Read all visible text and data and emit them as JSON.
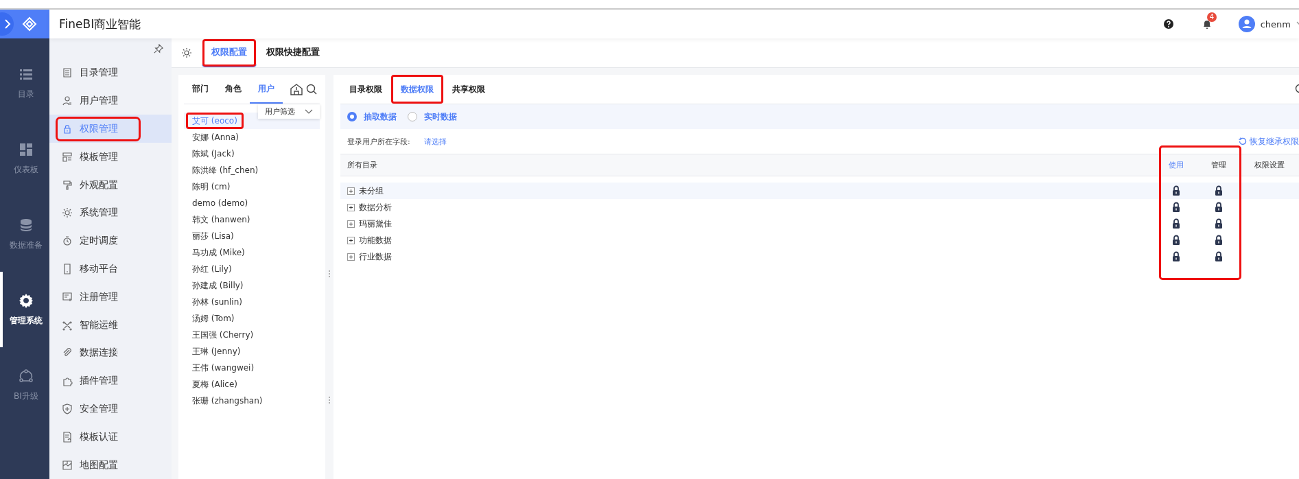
{
  "app": {
    "title": "FineBI商业智能"
  },
  "header": {
    "notification_count": "4",
    "user_name": "chenm"
  },
  "nav": [
    {
      "label": "目录",
      "selected": false
    },
    {
      "label": "仪表板",
      "selected": false
    },
    {
      "label": "数据准备",
      "selected": false
    },
    {
      "label": "管理系统",
      "selected": true
    },
    {
      "label": "BI升级",
      "selected": false
    }
  ],
  "sidebar": {
    "items": [
      {
        "label": "目录管理",
        "selected": false,
        "marked": false
      },
      {
        "label": "用户管理",
        "selected": false,
        "marked": false
      },
      {
        "label": "权限管理",
        "selected": true,
        "marked": true
      },
      {
        "label": "模板管理",
        "selected": false,
        "marked": false
      },
      {
        "label": "外观配置",
        "selected": false,
        "marked": false
      },
      {
        "label": "系统管理",
        "selected": false,
        "marked": false
      },
      {
        "label": "定时调度",
        "selected": false,
        "marked": false
      },
      {
        "label": "移动平台",
        "selected": false,
        "marked": false
      },
      {
        "label": "注册管理",
        "selected": false,
        "marked": false
      },
      {
        "label": "智能运维",
        "selected": false,
        "marked": false
      },
      {
        "label": "数据连接",
        "selected": false,
        "marked": false
      },
      {
        "label": "插件管理",
        "selected": false,
        "marked": false
      },
      {
        "label": "安全管理",
        "selected": false,
        "marked": false
      },
      {
        "label": "模板认证",
        "selected": false,
        "marked": false
      },
      {
        "label": "地图配置",
        "selected": false,
        "marked": false
      }
    ]
  },
  "config_tabs": [
    {
      "label": "权限配置",
      "selected": true,
      "marked": true
    },
    {
      "label": "权限快捷配置",
      "selected": false,
      "marked": false
    }
  ],
  "member_panel": {
    "tabs": [
      {
        "label": "部门",
        "selected": false
      },
      {
        "label": "角色",
        "selected": false
      },
      {
        "label": "用户",
        "selected": true
      }
    ],
    "filter": "用户筛选",
    "users": [
      {
        "label": "艾可 (eoco)",
        "selected": true,
        "marked": true
      },
      {
        "label": "安娜 (Anna)",
        "selected": false,
        "marked": false
      },
      {
        "label": "陈斌 (Jack)",
        "selected": false,
        "marked": false
      },
      {
        "label": "陈洪绛 (hf_chen)",
        "selected": false,
        "marked": false
      },
      {
        "label": "陈明 (cm)",
        "selected": false,
        "marked": false
      },
      {
        "label": "demo (demo)",
        "selected": false,
        "marked": false
      },
      {
        "label": "韩文 (hanwen)",
        "selected": false,
        "marked": false
      },
      {
        "label": "丽莎 (Lisa)",
        "selected": false,
        "marked": false
      },
      {
        "label": "马功成 (Mike)",
        "selected": false,
        "marked": false
      },
      {
        "label": "孙红 (Lily)",
        "selected": false,
        "marked": false
      },
      {
        "label": "孙建成 (Billy)",
        "selected": false,
        "marked": false
      },
      {
        "label": "孙林 (sunlin)",
        "selected": false,
        "marked": false
      },
      {
        "label": "汤姆 (Tom)",
        "selected": false,
        "marked": false
      },
      {
        "label": "王国强 (Cherry)",
        "selected": false,
        "marked": false
      },
      {
        "label": "王琳 (Jenny)",
        "selected": false,
        "marked": false
      },
      {
        "label": "王伟 (wangwei)",
        "selected": false,
        "marked": false
      },
      {
        "label": "夏梅 (Alice)",
        "selected": false,
        "marked": false
      },
      {
        "label": "张珊 (zhangshan)",
        "selected": false,
        "marked": false
      }
    ]
  },
  "permission_panel": {
    "tabs": [
      {
        "label": "目录权限",
        "selected": false,
        "marked": false
      },
      {
        "label": "数据权限",
        "selected": true,
        "marked": true
      },
      {
        "label": "共享权限",
        "selected": false,
        "marked": false
      }
    ],
    "data_modes": [
      {
        "label": "抽取数据",
        "selected": true
      },
      {
        "label": "实时数据",
        "selected": false
      }
    ],
    "login_field_label": "登录用户所在字段:",
    "login_field_value": "请选择",
    "restore_link": "恢复继承权限",
    "columns": [
      {
        "label": "所有目录",
        "selected": false
      },
      {
        "label": "使用",
        "selected": true
      },
      {
        "label": "管理",
        "selected": false
      },
      {
        "label": "权限设置",
        "selected": false
      }
    ],
    "marked_columns": true,
    "rows": [
      {
        "label": "未分组",
        "expanded": false,
        "use_locked": true,
        "manage_locked": true
      },
      {
        "label": "数据分析",
        "expanded": false,
        "use_locked": true,
        "manage_locked": true
      },
      {
        "label": "玛丽黛佳",
        "expanded": false,
        "use_locked": true,
        "manage_locked": true
      },
      {
        "label": "功能数据",
        "expanded": false,
        "use_locked": true,
        "manage_locked": true
      },
      {
        "label": "行业数据",
        "expanded": false,
        "use_locked": true,
        "manage_locked": true
      }
    ]
  }
}
